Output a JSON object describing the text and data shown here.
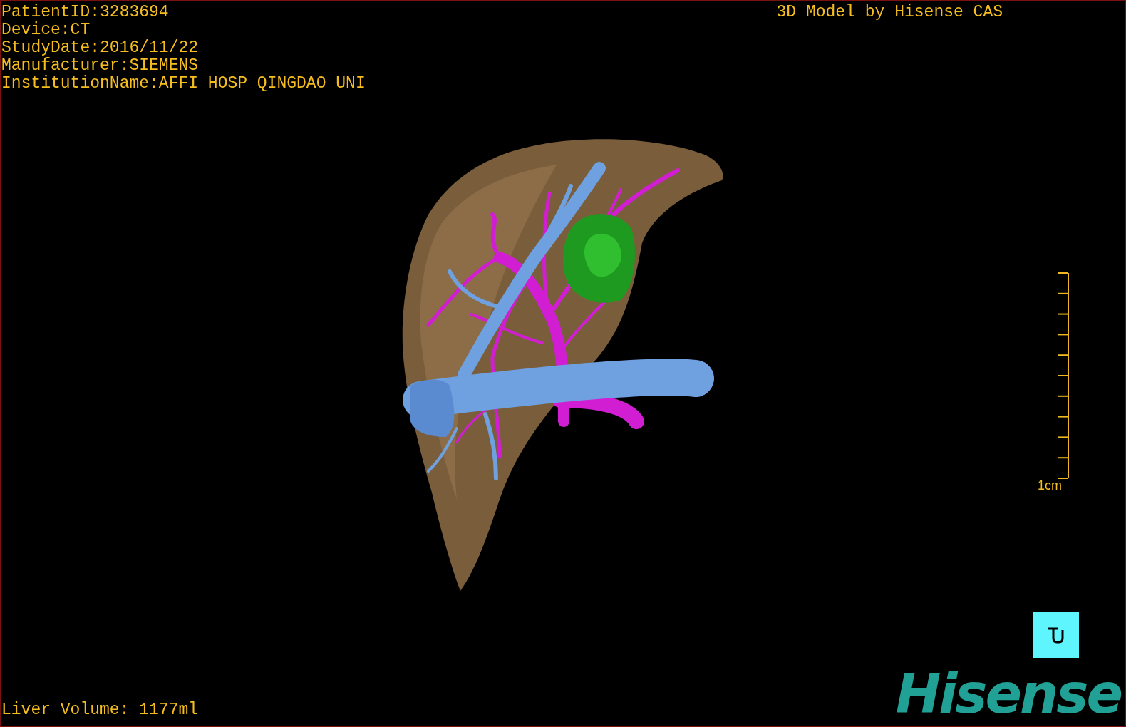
{
  "patient_info": [
    "PatientID:3283694",
    "Device:CT",
    "StudyDate:2016/11/22",
    "Manufacturer:SIEMENS",
    "InstitutionName:AFFI HOSP QINGDAO UNI"
  ],
  "credit": "3D Model by Hisense CAS",
  "scale_bar": {
    "label": "1cm"
  },
  "liver_volume": "Liver Volume: 1177ml",
  "logo": "Hisense"
}
